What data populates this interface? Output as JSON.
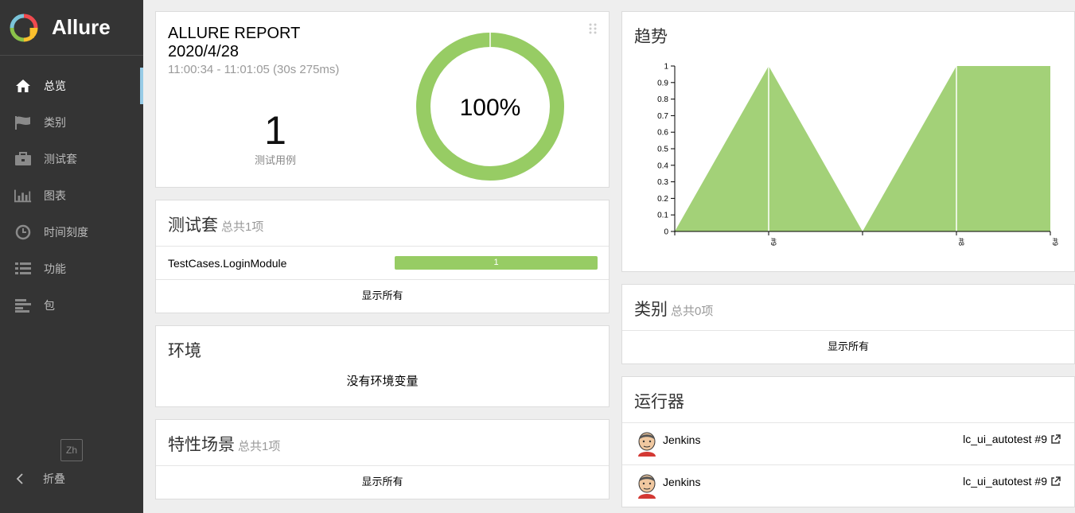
{
  "brand": {
    "name": "Allure"
  },
  "sidebar": {
    "items": [
      {
        "label": "总览",
        "icon": "home-icon",
        "active": true
      },
      {
        "label": "类别",
        "icon": "flag-icon",
        "active": false
      },
      {
        "label": "测试套",
        "icon": "briefcase-icon",
        "active": false
      },
      {
        "label": "图表",
        "icon": "bar-chart-icon",
        "active": false
      },
      {
        "label": "时间刻度",
        "icon": "clock-icon",
        "active": false
      },
      {
        "label": "功能",
        "icon": "list-icon",
        "active": false
      },
      {
        "label": "包",
        "icon": "align-left-icon",
        "active": false
      }
    ],
    "lang": "Zh",
    "collapse_label": "折叠"
  },
  "summary": {
    "title_line1": "ALLURE REPORT",
    "title_line2": "2020/4/28",
    "time": "11:00:34 - 11:01:05 (30s 275ms)",
    "test_count": "1",
    "test_count_label": "测试用例",
    "pass_percent": "100%",
    "pass_fraction": 1.0
  },
  "suites": {
    "title": "测试套",
    "count": "总共1项",
    "rows": [
      {
        "name": "TestCases.LoginModule",
        "value": "1"
      }
    ],
    "show_all": "显示所有"
  },
  "environment": {
    "title": "环境",
    "empty": "没有环境变量"
  },
  "features": {
    "title": "特性场景",
    "count": "总共1项",
    "show_all": "显示所有"
  },
  "trend": {
    "title": "趋势"
  },
  "chart_data": {
    "type": "area",
    "x": [
      "#9",
      "",
      "#8",
      "#9"
    ],
    "series": [
      {
        "values": [
          0,
          1,
          0,
          1,
          1
        ]
      }
    ],
    "x_positions": [
      0,
      1,
      2,
      3,
      4
    ],
    "tick_labels_y": [
      "0",
      "0.1",
      "0.2",
      "0.3",
      "0.4",
      "0.5",
      "0.6",
      "0.7",
      "0.8",
      "0.9",
      "1"
    ],
    "x_tick_labels": [
      {
        "label": "#9",
        "at": 1
      },
      {
        "label": "#8",
        "at": 3
      },
      {
        "label": "#9",
        "at": 4
      }
    ],
    "ylim": [
      0,
      1
    ],
    "color": "#a3d178"
  },
  "categories": {
    "title": "类别",
    "count": "总共0项",
    "show_all": "显示所有"
  },
  "executors": {
    "title": "运行器",
    "rows": [
      {
        "name": "Jenkins",
        "link": "lc_ui_autotest #9"
      },
      {
        "name": "Jenkins",
        "link": "lc_ui_autotest #9"
      }
    ]
  },
  "colors": {
    "passed": "#97cc64",
    "sidebar_bg": "#343434",
    "accent": "#97cbe6"
  }
}
